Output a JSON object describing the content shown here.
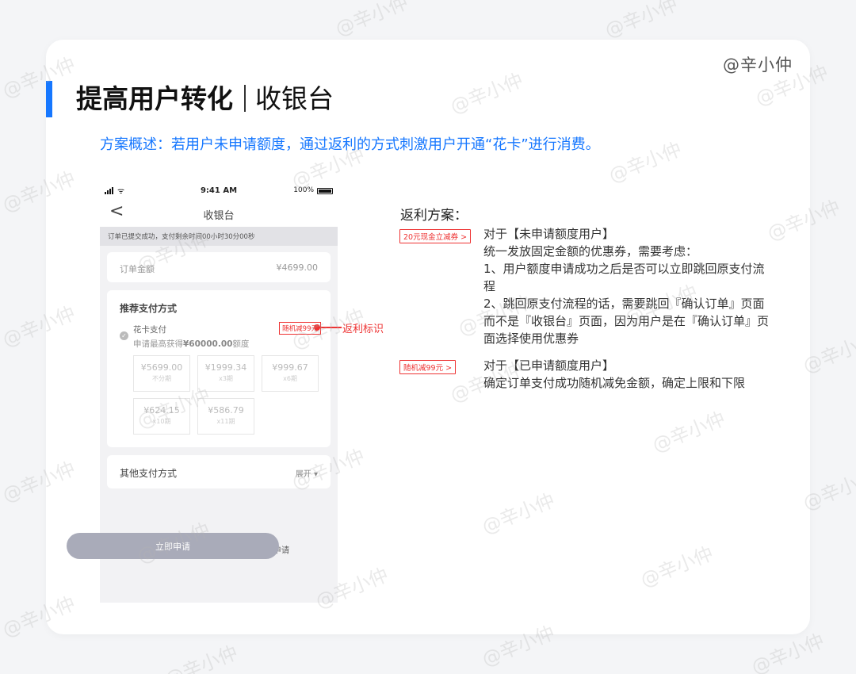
{
  "author": "@辛小仲",
  "watermark": "@辛小仲",
  "title": {
    "strong": "提高用户转化",
    "light": "收银台"
  },
  "subtitle": "方案概述：若用户未申请额度，通过返利的方式刺激用户开通“花卡”进行消费。",
  "phone": {
    "status": {
      "time": "9:41 AM",
      "battery": "100%"
    },
    "nav": {
      "back": "<",
      "title": "收银台"
    },
    "notice": "订单已提交成功，支付剩余时间00小时30分00秒",
    "order": {
      "label": "订单金额",
      "amount": "¥4699.00"
    },
    "recommend": {
      "heading": "推荐支付方式",
      "method": "花卡支付",
      "desc_prefix": "申请最高获得",
      "desc_amount": "¥60000.00",
      "desc_suffix": "额度",
      "tag": "随机减99元",
      "plans": [
        {
          "price": "¥5699.00",
          "note": "不分期"
        },
        {
          "price": "¥1999.34",
          "note": "x3期"
        },
        {
          "price": "¥999.67",
          "note": "x6期"
        },
        {
          "price": "¥624.15",
          "note": "x10期"
        },
        {
          "price": "¥586.79",
          "note": "x11期"
        }
      ]
    },
    "other": {
      "label": "其他支付方式",
      "expand": "展开"
    },
    "hint": "您还暂未有额度，请点击下方立即申请"
  },
  "apply_button": "立即申请",
  "callout": "返利标识",
  "fanli": {
    "title": "返利方案：",
    "items": [
      {
        "tag": "20元现金立减券",
        "lines": [
          "对于【未申请额度用户】",
          "统一发放固定金额的优惠券，需要考虑：",
          "1、用户额度申请成功之后是否可以立即跳回原支付流程",
          "2、跳回原支付流程的话，需要跳回『确认订单』页面而不是『收银台』页面，因为用户是在『确认订单』页面选择使用优惠券"
        ]
      },
      {
        "tag": "随机减99元",
        "lines": [
          "对于【已申请额度用户】",
          "确定订单支付成功随机减免金额，确定上限和下限"
        ]
      }
    ]
  }
}
